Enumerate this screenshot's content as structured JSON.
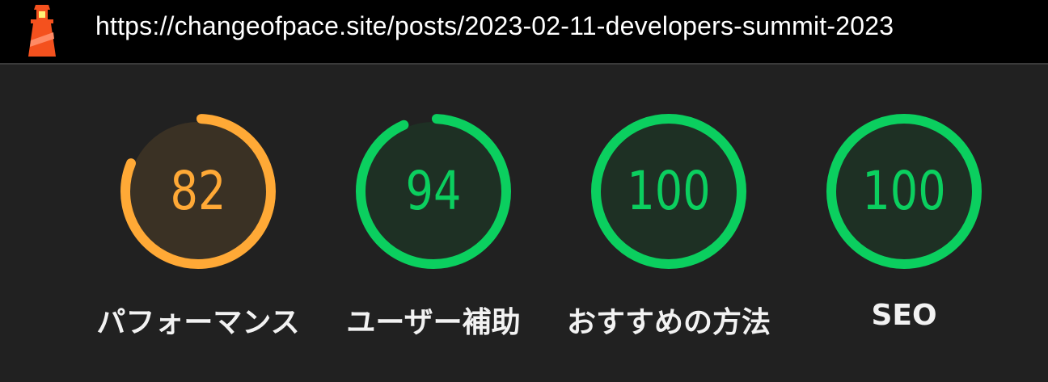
{
  "header": {
    "url": "https://changeofpace.site/posts/2023-02-11-developers-summit-2023",
    "logo_icon": "lighthouse-icon"
  },
  "colors": {
    "average": "#ffa936",
    "average_bg": "#3a3124",
    "pass": "#0bcf5f",
    "pass_bg": "#1e3024",
    "track": "#2a2a2a"
  },
  "gauges": [
    {
      "score": "82",
      "value": 82,
      "label": "パフォーマンス",
      "status": "average"
    },
    {
      "score": "94",
      "value": 94,
      "label": "ユーザー補助",
      "status": "pass"
    },
    {
      "score": "100",
      "value": 100,
      "label": "おすすめの方法",
      "status": "pass"
    },
    {
      "score": "100",
      "value": 100,
      "label": "SEO",
      "status": "pass"
    }
  ]
}
